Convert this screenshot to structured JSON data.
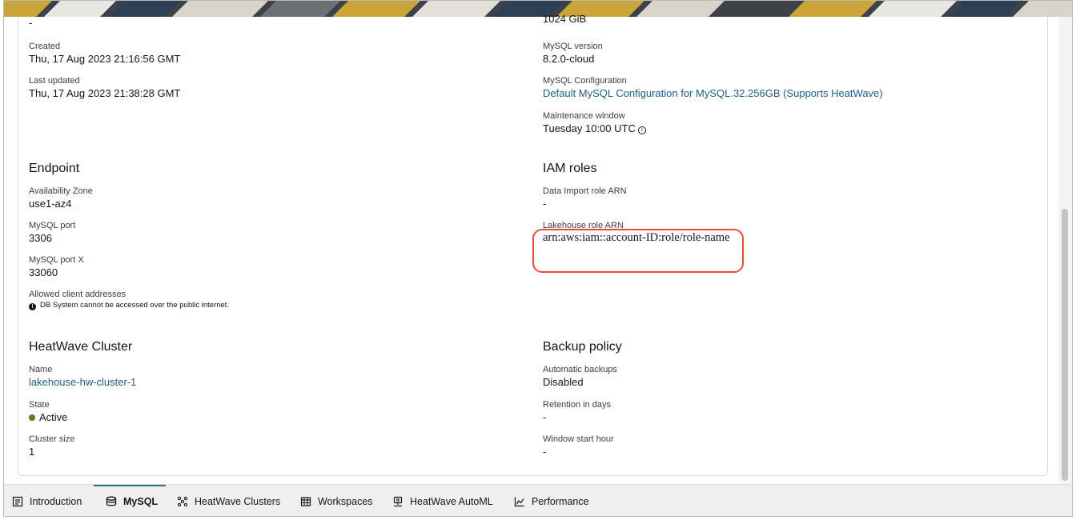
{
  "colors": {
    "link": "#1f5d8c",
    "active_status": "#508223",
    "highlight_box": "#e84c3d",
    "tab_indicator": "#31708c"
  },
  "top_partial": {
    "left_value": "-",
    "right_value": "1024 GiB"
  },
  "general": {
    "created": {
      "label": "Created",
      "value": "Thu, 17 Aug 2023 21:16:56 GMT"
    },
    "last_updated": {
      "label": "Last updated",
      "value": "Thu, 17 Aug 2023 21:38:28 GMT"
    },
    "mysql_version": {
      "label": "MySQL version",
      "value": "8.2.0-cloud"
    },
    "mysql_configuration": {
      "label": "MySQL Configuration",
      "value": "Default MySQL Configuration for MySQL.32.256GB (Supports HeatWave)"
    },
    "maintenance_window": {
      "label": "Maintenance window",
      "value": "Tuesday 10:00 UTC",
      "icon": "info-icon"
    }
  },
  "endpoint": {
    "title": "Endpoint",
    "availability_zone": {
      "label": "Availability Zone",
      "value": "use1-az4"
    },
    "mysql_port": {
      "label": "MySQL port",
      "value": "3306"
    },
    "mysql_port_x": {
      "label": "MySQL port X",
      "value": "33060"
    },
    "allowed_clients": {
      "label": "Allowed client addresses",
      "note": "DB System cannot be accessed over the public internet.",
      "icon": "info-filled-icon"
    }
  },
  "iam_roles": {
    "title": "IAM roles",
    "data_import_role": {
      "label": "Data Import role ARN",
      "value": "-"
    },
    "lakehouse_role": {
      "label": "Lakehouse role ARN",
      "value": "arn:aws:iam::account-ID:role/role-name"
    }
  },
  "heatwave_cluster": {
    "title": "HeatWave Cluster",
    "name": {
      "label": "Name",
      "value": "lakehouse-hw-cluster-1"
    },
    "state": {
      "label": "State",
      "value": "Active"
    },
    "cluster_size": {
      "label": "Cluster size",
      "value": "1"
    }
  },
  "backup_policy": {
    "title": "Backup policy",
    "automatic_backups": {
      "label": "Automatic backups",
      "value": "Disabled"
    },
    "retention_days": {
      "label": "Retention in days",
      "value": "-"
    },
    "window_start_hour": {
      "label": "Window start hour",
      "value": "-"
    }
  },
  "tabs": [
    {
      "label": "Introduction",
      "icon": "document-icon"
    },
    {
      "label": "MySQL",
      "icon": "database-icon",
      "active": true
    },
    {
      "label": "HeatWave Clusters",
      "icon": "cluster-icon"
    },
    {
      "label": "Workspaces",
      "icon": "table-icon"
    },
    {
      "label": "HeatWave AutoML",
      "icon": "automl-icon"
    },
    {
      "label": "Performance",
      "icon": "chart-icon"
    }
  ]
}
